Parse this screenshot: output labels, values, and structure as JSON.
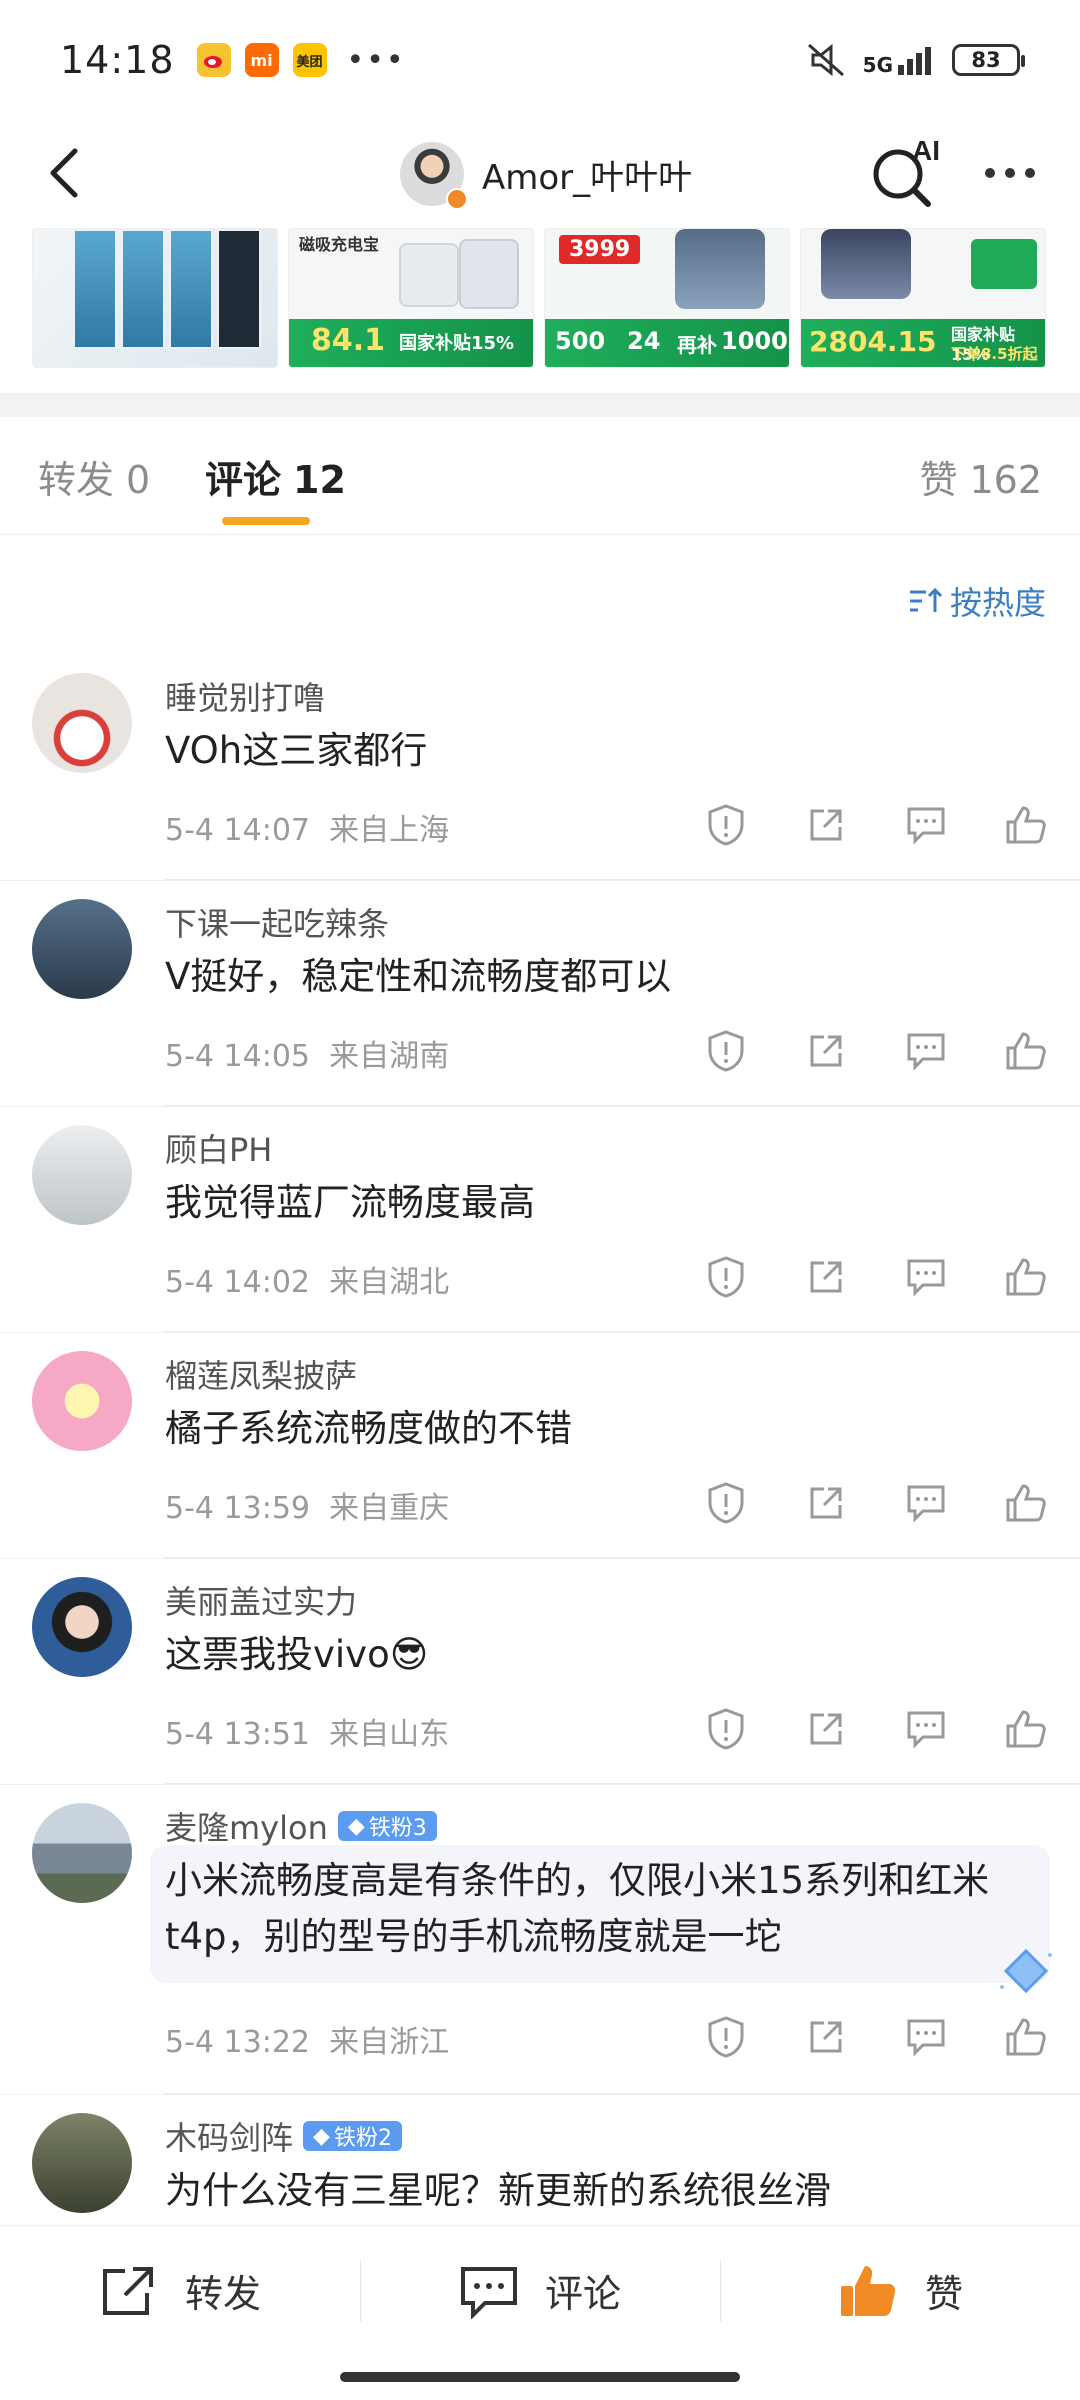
{
  "status_bar": {
    "time": "14:18",
    "app_icons": [
      {
        "name": "weibo-app-icon",
        "label": "",
        "color": "#f7c22f"
      },
      {
        "name": "mi-app-icon",
        "label": "mi",
        "color": "#ff6a00"
      },
      {
        "name": "meituan-app-icon",
        "label": "美团",
        "color": "#ffc300"
      }
    ],
    "more": "•••",
    "network": "5G",
    "battery": "83"
  },
  "nav": {
    "title": "Amor_叶叶叶"
  },
  "products": [
    {
      "name": "facial-mask"
    },
    {
      "name": "magsafe-power-bank",
      "header": "磁吸充电宝",
      "badge": "国家补贴15%",
      "price": "84.1"
    },
    {
      "name": "phone-deal",
      "price": "3999",
      "badge": "再补",
      "amounts": [
        "500",
        "24",
        "1000"
      ]
    },
    {
      "name": "phone-subsidy",
      "price": "2804.15",
      "badge": "国家补贴 15%",
      "sub": "下单8.5折起"
    }
  ],
  "tabs": {
    "repost": {
      "label": "转发",
      "count": "0"
    },
    "comment": {
      "label": "评论",
      "count": "12"
    },
    "like": {
      "label": "赞",
      "count": "162"
    }
  },
  "sort": {
    "label": "按热度"
  },
  "comments": [
    {
      "user": "睡觉别打噜",
      "text": "VOh这三家都行",
      "time": "5-4 14:07",
      "location": "来自上海",
      "badge": "",
      "avatar_color": "#e9e4df"
    },
    {
      "user": "下课一起吃辣条",
      "text": "V挺好，稳定性和流畅度都可以",
      "time": "5-4 14:05",
      "location": "来自湖南",
      "badge": "",
      "avatar_color": "#3e5368"
    },
    {
      "user": "顾白PH",
      "text": "我觉得蓝厂流畅度最高",
      "time": "5-4 14:02",
      "location": "来自湖北",
      "badge": "",
      "avatar_color": "#d7d9dc"
    },
    {
      "user": "榴莲凤梨披萨",
      "text": "橘子系统流畅度做的不错",
      "time": "5-4 13:59",
      "location": "来自重庆",
      "badge": "",
      "avatar_color": "#f5a9c6"
    },
    {
      "user": "美丽盖过实力",
      "text": "这票我投vivo😎",
      "time": "5-4 13:51",
      "location": "来自山东",
      "badge": "",
      "avatar_color": "#2a2a2a"
    },
    {
      "user": "麦隆mylon",
      "text": "小米流畅度高是有条件的，仅限小米15系列和红米t4p，别的型号的手机流畅度就是一坨",
      "time": "5-4 13:22",
      "location": "来自浙江",
      "badge": "铁粉3",
      "avatar_color": "#8a98a8"
    },
    {
      "user": "木码剑阵",
      "text": "为什么没有三星呢？新更新的系统很丝滑",
      "time": "",
      "location": "",
      "badge": "铁粉2",
      "avatar_color": "#4b5240"
    }
  ],
  "toolbar": {
    "repost": "转发",
    "comment": "评论",
    "like": "赞"
  },
  "colors": {
    "accent": "#f5a623",
    "link": "#3c7ec4",
    "like_orange": "#f08a24",
    "fan_badge": "#5b9cf0"
  }
}
